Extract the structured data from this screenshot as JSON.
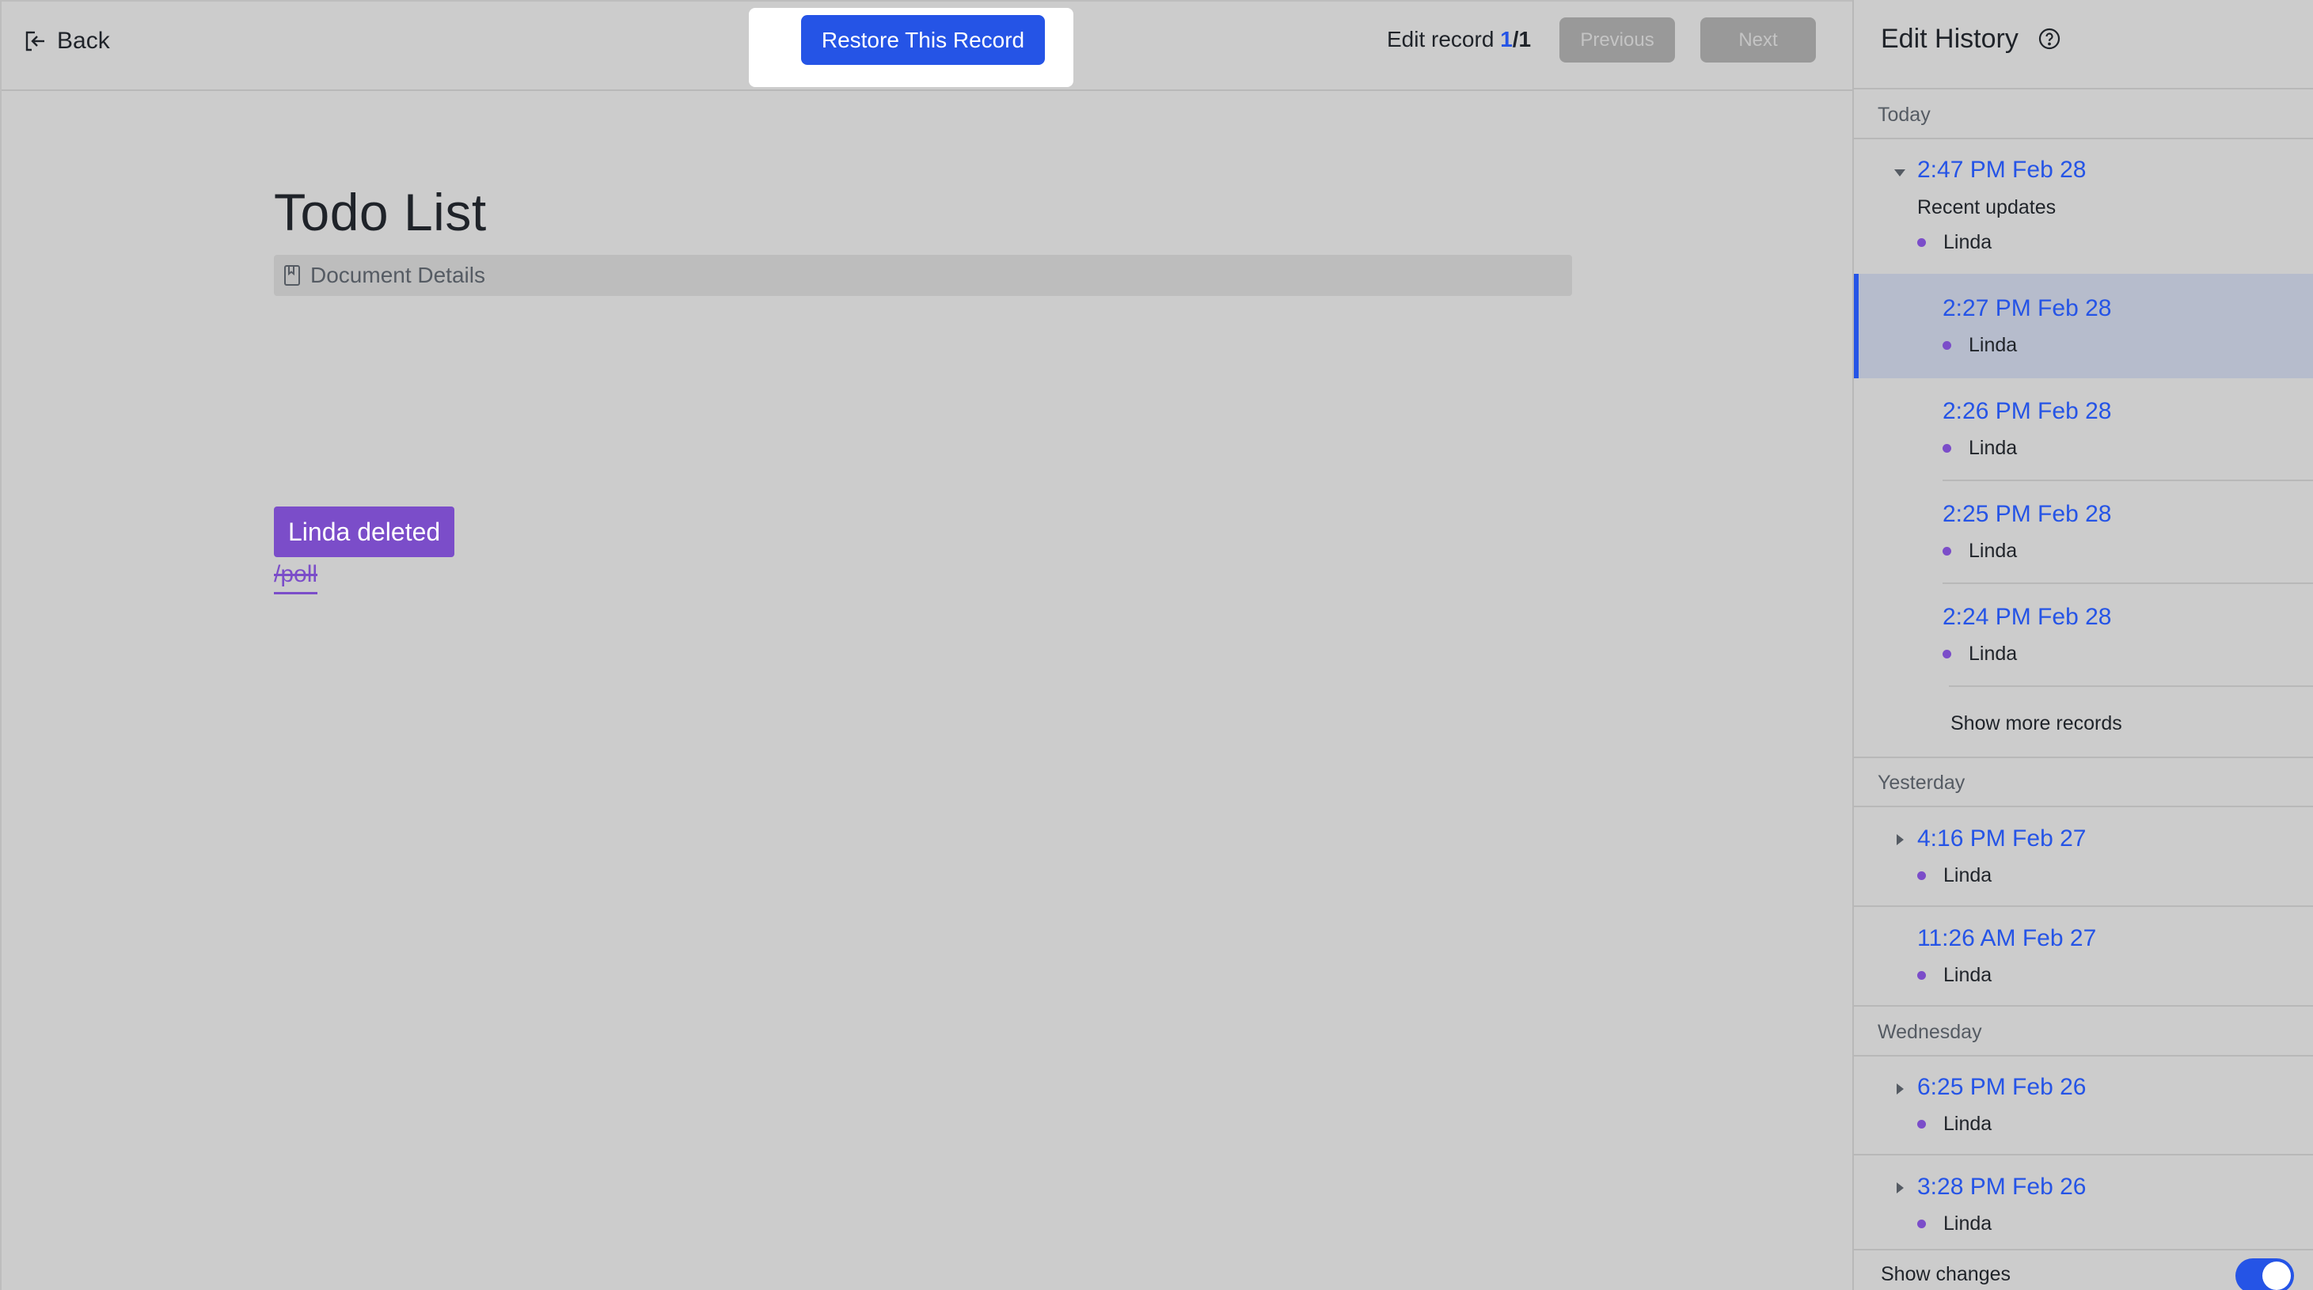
{
  "topbar": {
    "back_label": "Back",
    "restore_label": "Restore This Record",
    "record_label": "Edit record",
    "record_current": "1",
    "record_separator": "/",
    "record_total": "1",
    "previous_label": "Previous",
    "next_label": "Next"
  },
  "document": {
    "title": "Todo List",
    "details_label": "Document Details",
    "deleted_badge": "Linda deleted",
    "deleted_text": "/poll"
  },
  "sidebar": {
    "title": "Edit History",
    "groups": [
      {
        "label": "Today"
      },
      {
        "label": "Yesterday"
      },
      {
        "label": "Wednesday"
      }
    ],
    "entries": [
      {
        "time": "2:47 PM Feb 28",
        "subtitle": "Recent updates",
        "user": "Linda"
      },
      {
        "time": "2:27 PM Feb 28",
        "user": "Linda"
      },
      {
        "time": "2:26 PM Feb 28",
        "user": "Linda"
      },
      {
        "time": "2:25 PM Feb 28",
        "user": "Linda"
      },
      {
        "time": "2:24 PM Feb 28",
        "user": "Linda"
      },
      {
        "time": "4:16 PM Feb 27",
        "user": "Linda"
      },
      {
        "time": "11:26 AM Feb 27",
        "user": "Linda"
      },
      {
        "time": "6:25 PM Feb 26",
        "user": "Linda"
      },
      {
        "time": "3:28 PM Feb 26",
        "user": "Linda"
      }
    ],
    "show_more_label": "Show more records",
    "show_changes_label": "Show changes",
    "show_changes_on": true
  },
  "colors": {
    "accent": "#2554e6",
    "deleted": "#7b4dc9",
    "selected_bg": "#b6bccc"
  }
}
